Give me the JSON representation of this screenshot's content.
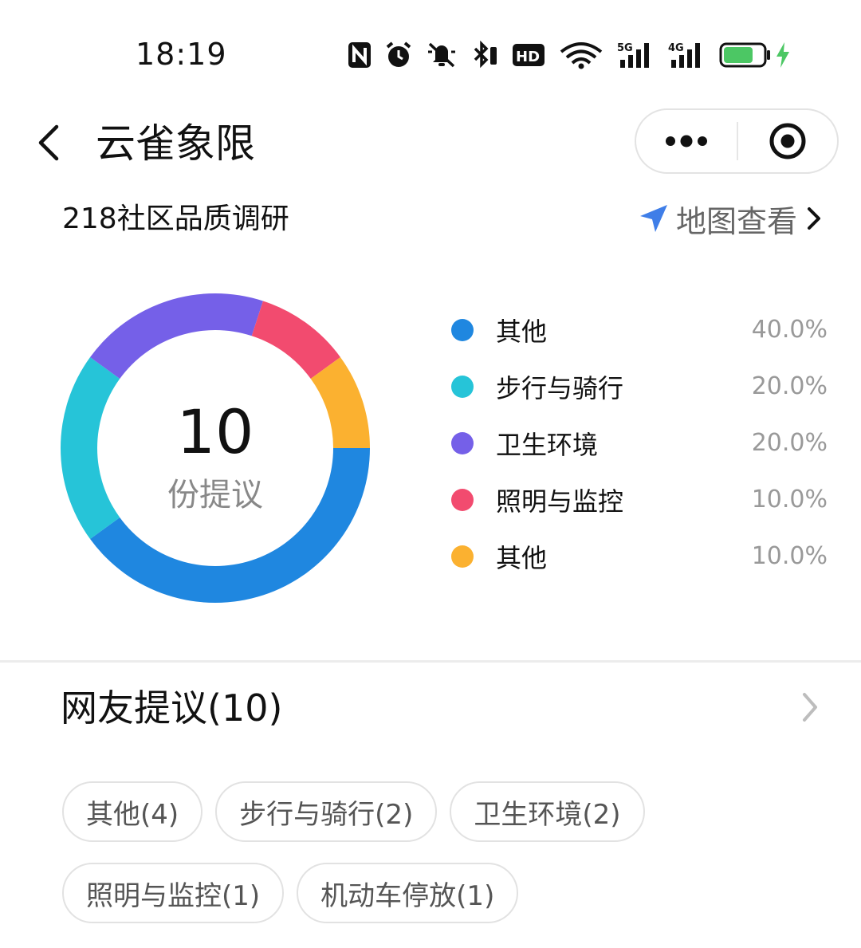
{
  "status_bar": {
    "time": "18:19",
    "icons": [
      "nfc-icon",
      "alarm-icon",
      "mute-icon",
      "bluetooth-icon",
      "hd-icon",
      "wifi-icon",
      "signal-5g-icon",
      "signal-4g-icon",
      "battery-icon",
      "charging-icon"
    ],
    "hd_label": "HD",
    "net1_label": "5G",
    "net2_label": "4G",
    "battery_level": 0.75,
    "battery_color": "#4cc764"
  },
  "nav": {
    "title": "云雀象限"
  },
  "header": {
    "subtitle": "218社区品质调研",
    "map_link": "地图查看"
  },
  "summary": {
    "count": "10",
    "unit_label": "份提议"
  },
  "chart_data": {
    "type": "pie",
    "categories": [
      "其他",
      "步行与骑行",
      "卫生环境",
      "照明与监控",
      "其他"
    ],
    "values": [
      40.0,
      20.0,
      20.0,
      10.0,
      10.0
    ],
    "value_labels": [
      "40.0%",
      "20.0%",
      "20.0%",
      "10.0%",
      "10.0%"
    ],
    "colors": [
      "#1f87e0",
      "#26c4d8",
      "#7560e8",
      "#f24b6f",
      "#fbb130"
    ],
    "start": "3 o'clock",
    "direction": "clockwise",
    "legend_position": "right"
  },
  "suggestions": {
    "title": "网友提议(10)",
    "tags": [
      [
        "其他(4)",
        "步行与骑行(2)",
        "卫生环境(2)"
      ],
      [
        "照明与监控(1)",
        "机动车停放(1)"
      ]
    ]
  }
}
